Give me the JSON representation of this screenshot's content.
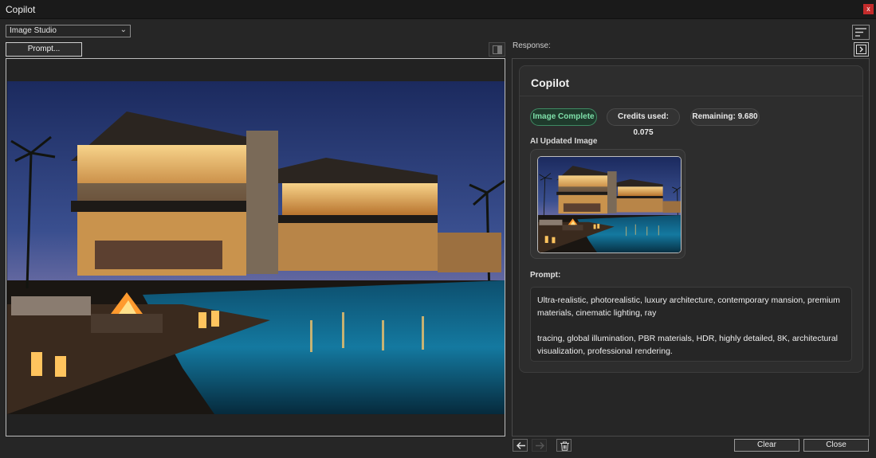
{
  "window": {
    "title": "Copilot",
    "close_glyph": "x"
  },
  "toolbar": {
    "mode_select_value": "Image Studio",
    "prompt_button": "Prompt...",
    "response_label": "Response:"
  },
  "card": {
    "title": "Copilot",
    "status_badge": "Image Complete",
    "credits_used": "Credits used: 0.075",
    "remaining": "Remaining: 9.680",
    "image_heading": "AI Updated Image",
    "prompt_heading": "Prompt:",
    "prompt_line1": "Ultra-realistic, photorealistic, luxury architecture, contemporary mansion, premium materials, cinematic lighting, ray",
    "prompt_line2": "tracing, global illumination, PBR materials, HDR, highly detailed, 8K, architectural visualization, professional rendering."
  },
  "footer": {
    "clear_button": "Clear",
    "close_button": "Close"
  },
  "icons": [
    "chevron-down-icon",
    "split-view-icon",
    "sort-lines-icon",
    "collapse-panel-icon",
    "back-arrow-icon",
    "forward-arrow-icon",
    "trash-icon",
    "close-icon"
  ],
  "colors": {
    "status_green": "#7fe0aa",
    "window_close": "#c42b2b",
    "background": "#262626"
  }
}
